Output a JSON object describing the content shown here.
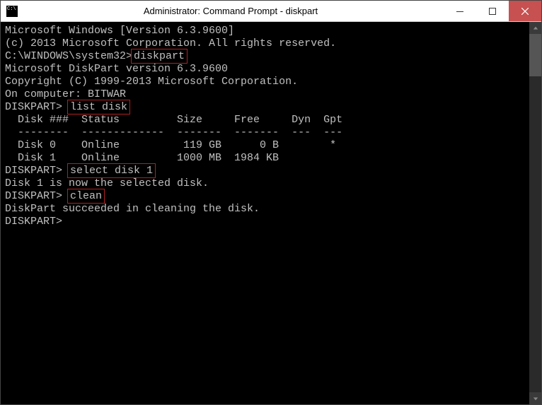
{
  "window": {
    "title": "Administrator: Command Prompt - diskpart"
  },
  "console": {
    "lines": {
      "l0": "Microsoft Windows [Version 6.3.9600]",
      "l1": "(c) 2013 Microsoft Corporation. All rights reserved.",
      "l2": "",
      "l3_prompt": "C:\\WINDOWS\\system32>",
      "l3_cmd": "diskpart",
      "l4": "",
      "l5": "Microsoft DiskPart version 6.3.9600",
      "l6": "",
      "l7": "Copyright (C) 1999-2013 Microsoft Corporation.",
      "l8": "On computer: BITWAR",
      "l9": "",
      "l10_prompt": "DISKPART> ",
      "l10_cmd": "list disk",
      "l11": "",
      "l12": "  Disk ###  Status         Size     Free     Dyn  Gpt",
      "l13": "  --------  -------------  -------  -------  ---  ---",
      "l14": "  Disk 0    Online          119 GB      0 B        *",
      "l15": "  Disk 1    Online         1000 MB  1984 KB",
      "l16": "",
      "l17_prompt": "DISKPART> ",
      "l17_cmd": "select disk 1",
      "l18": "",
      "l19": "Disk 1 is now the selected disk.",
      "l20": "",
      "l21_prompt": "DISKPART> ",
      "l21_cmd": "clean",
      "l22": "",
      "l23": "DiskPart succeeded in cleaning the disk.",
      "l24": "",
      "l25": "DISKPART>"
    }
  }
}
